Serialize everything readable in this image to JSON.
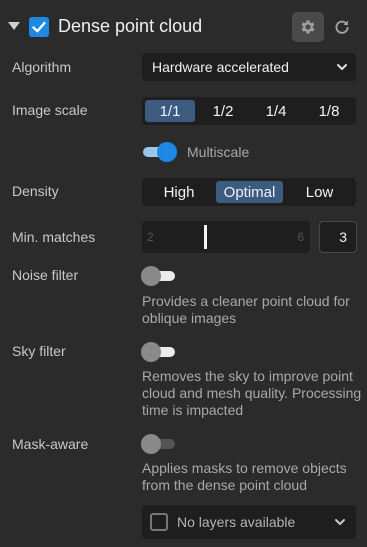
{
  "header": {
    "title": "Dense point cloud",
    "enabled": true,
    "icons": {
      "collapse": "caret-down-icon",
      "settings": "gear-icon",
      "reset": "refresh-icon",
      "check": "check-icon"
    }
  },
  "algorithm": {
    "label": "Algorithm",
    "value": "Hardware accelerated"
  },
  "image_scale": {
    "label": "Image scale",
    "options": [
      "1/1",
      "1/2",
      "1/4",
      "1/8"
    ],
    "selected": "1/1"
  },
  "multiscale": {
    "label": "Multiscale",
    "on": true
  },
  "density": {
    "label": "Density",
    "options": [
      "High",
      "Optimal",
      "Low"
    ],
    "selected": "Optimal"
  },
  "min_matches": {
    "label": "Min. matches",
    "min": "2",
    "max": "6",
    "value": "3"
  },
  "noise_filter": {
    "label": "Noise filter",
    "on": false,
    "description": "Provides a cleaner point cloud for oblique images"
  },
  "sky_filter": {
    "label": "Sky filter",
    "on": false,
    "description": "Removes the sky to improve point cloud and mesh quality. Processing time is impacted"
  },
  "mask_aware": {
    "label": "Mask-aware",
    "on": false,
    "description": "Applies masks to remove objects from the dense point cloud",
    "layers_placeholder": "No layers available"
  },
  "colors": {
    "accent": "#1e88e5",
    "panel": "#2b2b2b",
    "field": "#1e1e1e",
    "selected_segment": "#3d5a80"
  }
}
